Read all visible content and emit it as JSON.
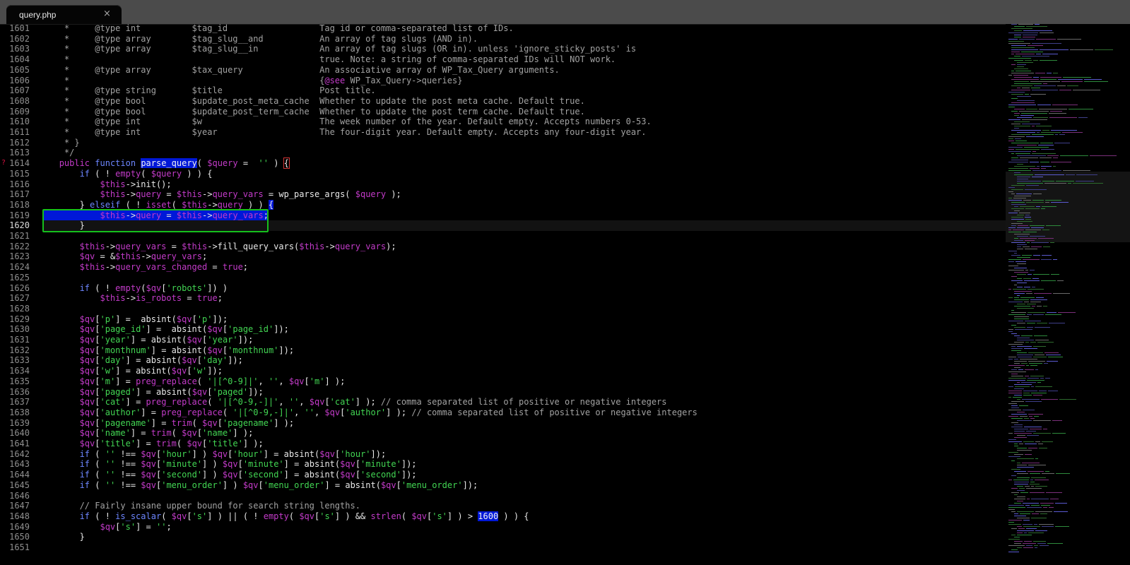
{
  "tab": {
    "title": "query.php",
    "close_label": "×"
  },
  "gutter": {
    "start": 1601,
    "current": 1620,
    "bookmark_line": 1614,
    "bookmark_glyph": "?"
  },
  "colors": {
    "background": "#000000",
    "keyword": "#6d86ff",
    "variable": "#c33bc9",
    "string": "#42d653",
    "comment": "#a2a2a2",
    "selection": "#0018d8",
    "bracket_match": "#15c01c"
  },
  "lines": [
    [
      [
        "cm",
        "    *     @type int          $tag_id                  Tag id or comma-separated list of IDs."
      ]
    ],
    [
      [
        "cm",
        "    *     @type array        $tag_slug__and           An array of tag slugs (AND in)."
      ]
    ],
    [
      [
        "cm",
        "    *     @type array        $tag_slug__in            An array of tag slugs (OR in). unless 'ignore_sticky_posts' is"
      ]
    ],
    [
      [
        "cm",
        "    *                                                 true. Note: a string of comma-separated IDs will NOT work."
      ]
    ],
    [
      [
        "cm",
        "    *     @type array        $tax_query               An associative array of WP_Tax_Query arguments."
      ]
    ],
    [
      [
        "cm",
        "    *                                                 {"
      ],
      [
        "var",
        "@see"
      ],
      [
        "cm",
        " WP_Tax_Query->queries}"
      ]
    ],
    [
      [
        "cm",
        "    *     @type string       $title                   Post title."
      ]
    ],
    [
      [
        "cm",
        "    *     @type bool         $update_post_meta_cache  Whether to update the post meta cache. Default true."
      ]
    ],
    [
      [
        "cm",
        "    *     @type bool         $update_post_term_cache  Whether to update the post term cache. Default true."
      ]
    ],
    [
      [
        "cm",
        "    *     @type int          $w                       The week number of the year. Default empty. Accepts numbers 0-53."
      ]
    ],
    [
      [
        "cm",
        "    *     @type int          $year                    The four-digit year. Default empty. Accepts any four-digit year."
      ]
    ],
    [
      [
        "cm",
        "    * }"
      ]
    ],
    [
      [
        "cm",
        "    */"
      ]
    ],
    [
      [
        "",
        "   "
      ],
      [
        "var",
        "public"
      ],
      [
        "",
        "",
        " "
      ],
      [
        "kw",
        "function"
      ],
      [
        "",
        " "
      ],
      [
        "hl",
        "parse_query"
      ],
      [
        "",
        "( "
      ],
      [
        "var",
        "$query"
      ],
      [
        "",
        " =  "
      ],
      [
        "str",
        "''"
      ],
      [
        "",
        " ) "
      ],
      [
        "boxed",
        "{"
      ]
    ],
    [
      [
        "",
        "       "
      ],
      [
        "kw",
        "if"
      ],
      [
        "",
        " ( ! "
      ],
      [
        "var",
        "empty"
      ],
      [
        "",
        "( "
      ],
      [
        "var",
        "$query"
      ],
      [
        "",
        " ) ) {"
      ]
    ],
    [
      [
        "",
        "           "
      ],
      [
        "var",
        "$this"
      ],
      [
        "",
        "->init();"
      ]
    ],
    [
      [
        "",
        "           "
      ],
      [
        "var",
        "$this"
      ],
      [
        "",
        "->"
      ],
      [
        "prop",
        "query"
      ],
      [
        "",
        " = "
      ],
      [
        "var",
        "$this"
      ],
      [
        "",
        "->"
      ],
      [
        "prop",
        "query_vars"
      ],
      [
        "",
        " = wp_parse_args( "
      ],
      [
        "var",
        "$query"
      ],
      [
        "",
        " );"
      ]
    ],
    [
      [
        "",
        "       } "
      ],
      [
        "kw",
        "elseif"
      ],
      [
        "",
        " ( ! "
      ],
      [
        "var",
        "isset"
      ],
      [
        "",
        "( "
      ],
      [
        "var",
        "$this"
      ],
      [
        "",
        "->"
      ],
      [
        "prop",
        "query"
      ],
      [
        "",
        " ) ) "
      ],
      [
        "hl",
        "{"
      ]
    ],
    [
      [
        "",
        "           "
      ],
      [
        "var",
        "$this"
      ],
      [
        "",
        "->"
      ],
      [
        "prop",
        "query"
      ],
      [
        "",
        " = "
      ],
      [
        "var",
        "$this"
      ],
      [
        "",
        "->"
      ],
      [
        "prop",
        "query_vars"
      ],
      [
        "",
        ";"
      ]
    ],
    [
      [
        "",
        "       }"
      ]
    ],
    [
      [
        "",
        ""
      ]
    ],
    [
      [
        "",
        "       "
      ],
      [
        "var",
        "$this"
      ],
      [
        "",
        "->"
      ],
      [
        "prop",
        "query_vars"
      ],
      [
        "",
        " = "
      ],
      [
        "var",
        "$this"
      ],
      [
        "",
        "->fill_query_vars("
      ],
      [
        "var",
        "$this"
      ],
      [
        "",
        "->"
      ],
      [
        "prop",
        "query_vars"
      ],
      [
        "",
        ");"
      ]
    ],
    [
      [
        "",
        "       "
      ],
      [
        "var",
        "$qv"
      ],
      [
        "",
        " = &"
      ],
      [
        "var",
        "$this"
      ],
      [
        "",
        "->"
      ],
      [
        "prop",
        "query_vars"
      ],
      [
        "",
        ";"
      ]
    ],
    [
      [
        "",
        "       "
      ],
      [
        "var",
        "$this"
      ],
      [
        "",
        "->"
      ],
      [
        "prop",
        "query_vars_changed"
      ],
      [
        "",
        " = "
      ],
      [
        "var",
        "true"
      ],
      [
        "",
        ";"
      ]
    ],
    [
      [
        "",
        ""
      ]
    ],
    [
      [
        "",
        "       "
      ],
      [
        "kw",
        "if"
      ],
      [
        "",
        " ( ! "
      ],
      [
        "var",
        "empty"
      ],
      [
        "",
        "("
      ],
      [
        "var",
        "$qv"
      ],
      [
        "",
        "["
      ],
      [
        "str",
        "'robots'"
      ],
      [
        "",
        "]) )"
      ]
    ],
    [
      [
        "",
        "           "
      ],
      [
        "var",
        "$this"
      ],
      [
        "",
        "->"
      ],
      [
        "prop",
        "is_robots"
      ],
      [
        "",
        " = "
      ],
      [
        "var",
        "true"
      ],
      [
        "",
        ";"
      ]
    ],
    [
      [
        "",
        ""
      ]
    ],
    [
      [
        "",
        "       "
      ],
      [
        "var",
        "$qv"
      ],
      [
        "",
        "["
      ],
      [
        "str",
        "'p'"
      ],
      [
        "",
        "] =  absint("
      ],
      [
        "var",
        "$qv"
      ],
      [
        "",
        "["
      ],
      [
        "str",
        "'p'"
      ],
      [
        "",
        "]);"
      ]
    ],
    [
      [
        "",
        "       "
      ],
      [
        "var",
        "$qv"
      ],
      [
        "",
        "["
      ],
      [
        "str",
        "'page_id'"
      ],
      [
        "",
        "] =  absint("
      ],
      [
        "var",
        "$qv"
      ],
      [
        "",
        "["
      ],
      [
        "str",
        "'page_id'"
      ],
      [
        "",
        "]);"
      ]
    ],
    [
      [
        "",
        "       "
      ],
      [
        "var",
        "$qv"
      ],
      [
        "",
        "["
      ],
      [
        "str",
        "'year'"
      ],
      [
        "",
        "] = absint("
      ],
      [
        "var",
        "$qv"
      ],
      [
        "",
        "["
      ],
      [
        "str",
        "'year'"
      ],
      [
        "",
        "]);"
      ]
    ],
    [
      [
        "",
        "       "
      ],
      [
        "var",
        "$qv"
      ],
      [
        "",
        "["
      ],
      [
        "str",
        "'monthnum'"
      ],
      [
        "",
        "] = absint("
      ],
      [
        "var",
        "$qv"
      ],
      [
        "",
        "["
      ],
      [
        "str",
        "'monthnum'"
      ],
      [
        "",
        "]);"
      ]
    ],
    [
      [
        "",
        "       "
      ],
      [
        "var",
        "$qv"
      ],
      [
        "",
        "["
      ],
      [
        "str",
        "'day'"
      ],
      [
        "",
        "] = absint("
      ],
      [
        "var",
        "$qv"
      ],
      [
        "",
        "["
      ],
      [
        "str",
        "'day'"
      ],
      [
        "",
        "]);"
      ]
    ],
    [
      [
        "",
        "       "
      ],
      [
        "var",
        "$qv"
      ],
      [
        "",
        "["
      ],
      [
        "str",
        "'w'"
      ],
      [
        "",
        "] = absint("
      ],
      [
        "var",
        "$qv"
      ],
      [
        "",
        "["
      ],
      [
        "str",
        "'w'"
      ],
      [
        "",
        "]);"
      ]
    ],
    [
      [
        "",
        "       "
      ],
      [
        "var",
        "$qv"
      ],
      [
        "",
        "["
      ],
      [
        "str",
        "'m'"
      ],
      [
        "",
        "] = "
      ],
      [
        "var",
        "preg_replace"
      ],
      [
        "",
        "( "
      ],
      [
        "str",
        "'|[^0-9]|'"
      ],
      [
        "",
        ", "
      ],
      [
        "str",
        "''"
      ],
      [
        "",
        ", "
      ],
      [
        "var",
        "$qv"
      ],
      [
        "",
        "["
      ],
      [
        "str",
        "'m'"
      ],
      [
        "",
        "] );"
      ]
    ],
    [
      [
        "",
        "       "
      ],
      [
        "var",
        "$qv"
      ],
      [
        "",
        "["
      ],
      [
        "str",
        "'paged'"
      ],
      [
        "",
        "] = absint("
      ],
      [
        "var",
        "$qv"
      ],
      [
        "",
        "["
      ],
      [
        "str",
        "'paged'"
      ],
      [
        "",
        "]);"
      ]
    ],
    [
      [
        "",
        "       "
      ],
      [
        "var",
        "$qv"
      ],
      [
        "",
        "["
      ],
      [
        "str",
        "'cat'"
      ],
      [
        "",
        "] = "
      ],
      [
        "var",
        "preg_replace"
      ],
      [
        "",
        "( "
      ],
      [
        "str",
        "'|[^0-9,-]|'"
      ],
      [
        "",
        ", "
      ],
      [
        "str",
        "''"
      ],
      [
        "",
        ", "
      ],
      [
        "var",
        "$qv"
      ],
      [
        "",
        "["
      ],
      [
        "str",
        "'cat'"
      ],
      [
        "",
        "] ); "
      ],
      [
        "cm",
        "// comma separated list of positive or negative integers"
      ]
    ],
    [
      [
        "",
        "       "
      ],
      [
        "var",
        "$qv"
      ],
      [
        "",
        "["
      ],
      [
        "str",
        "'author'"
      ],
      [
        "",
        "] = "
      ],
      [
        "var",
        "preg_replace"
      ],
      [
        "",
        "( "
      ],
      [
        "str",
        "'|[^0-9,-]|'"
      ],
      [
        "",
        ", "
      ],
      [
        "str",
        "''"
      ],
      [
        "",
        ", "
      ],
      [
        "var",
        "$qv"
      ],
      [
        "",
        "["
      ],
      [
        "str",
        "'author'"
      ],
      [
        "",
        "] ); "
      ],
      [
        "cm",
        "// comma separated list of positive or negative integers"
      ]
    ],
    [
      [
        "",
        "       "
      ],
      [
        "var",
        "$qv"
      ],
      [
        "",
        "["
      ],
      [
        "str",
        "'pagename'"
      ],
      [
        "",
        "] = "
      ],
      [
        "var",
        "trim"
      ],
      [
        "",
        "( "
      ],
      [
        "var",
        "$qv"
      ],
      [
        "",
        "["
      ],
      [
        "str",
        "'pagename'"
      ],
      [
        "",
        "] );"
      ]
    ],
    [
      [
        "",
        "       "
      ],
      [
        "var",
        "$qv"
      ],
      [
        "",
        "["
      ],
      [
        "str",
        "'name'"
      ],
      [
        "",
        "] = "
      ],
      [
        "var",
        "trim"
      ],
      [
        "",
        "( "
      ],
      [
        "var",
        "$qv"
      ],
      [
        "",
        "["
      ],
      [
        "str",
        "'name'"
      ],
      [
        "",
        "] );"
      ]
    ],
    [
      [
        "",
        "       "
      ],
      [
        "var",
        "$qv"
      ],
      [
        "",
        "["
      ],
      [
        "str",
        "'title'"
      ],
      [
        "",
        "] = "
      ],
      [
        "var",
        "trim"
      ],
      [
        "",
        "( "
      ],
      [
        "var",
        "$qv"
      ],
      [
        "",
        "["
      ],
      [
        "str",
        "'title'"
      ],
      [
        "",
        "] );"
      ]
    ],
    [
      [
        "",
        "       "
      ],
      [
        "kw",
        "if"
      ],
      [
        "",
        " ( "
      ],
      [
        "str",
        "''"
      ],
      [
        "",
        " !== "
      ],
      [
        "var",
        "$qv"
      ],
      [
        "",
        "["
      ],
      [
        "str",
        "'hour'"
      ],
      [
        "",
        "] ) "
      ],
      [
        "var",
        "$qv"
      ],
      [
        "",
        "["
      ],
      [
        "str",
        "'hour'"
      ],
      [
        "",
        "] = absint("
      ],
      [
        "var",
        "$qv"
      ],
      [
        "",
        "["
      ],
      [
        "str",
        "'hour'"
      ],
      [
        "",
        "]);"
      ]
    ],
    [
      [
        "",
        "       "
      ],
      [
        "kw",
        "if"
      ],
      [
        "",
        " ( "
      ],
      [
        "str",
        "''"
      ],
      [
        "",
        " !== "
      ],
      [
        "var",
        "$qv"
      ],
      [
        "",
        "["
      ],
      [
        "str",
        "'minute'"
      ],
      [
        "",
        "] ) "
      ],
      [
        "var",
        "$qv"
      ],
      [
        "",
        "["
      ],
      [
        "str",
        "'minute'"
      ],
      [
        "",
        "] = absint("
      ],
      [
        "var",
        "$qv"
      ],
      [
        "",
        "["
      ],
      [
        "str",
        "'minute'"
      ],
      [
        "",
        "]);"
      ]
    ],
    [
      [
        "",
        "       "
      ],
      [
        "kw",
        "if"
      ],
      [
        "",
        " ( "
      ],
      [
        "str",
        "''"
      ],
      [
        "",
        " !== "
      ],
      [
        "var",
        "$qv"
      ],
      [
        "",
        "["
      ],
      [
        "str",
        "'second'"
      ],
      [
        "",
        "] ) "
      ],
      [
        "var",
        "$qv"
      ],
      [
        "",
        "["
      ],
      [
        "str",
        "'second'"
      ],
      [
        "",
        "] = absint("
      ],
      [
        "var",
        "$qv"
      ],
      [
        "",
        "["
      ],
      [
        "str",
        "'second'"
      ],
      [
        "",
        "]);"
      ]
    ],
    [
      [
        "",
        "       "
      ],
      [
        "kw",
        "if"
      ],
      [
        "",
        " ( "
      ],
      [
        "str",
        "''"
      ],
      [
        "",
        " !== "
      ],
      [
        "var",
        "$qv"
      ],
      [
        "",
        "["
      ],
      [
        "str",
        "'menu_order'"
      ],
      [
        "",
        "] ) "
      ],
      [
        "var",
        "$qv"
      ],
      [
        "",
        "["
      ],
      [
        "str",
        "'menu_order'"
      ],
      [
        "",
        "] = absint("
      ],
      [
        "var",
        "$qv"
      ],
      [
        "",
        "["
      ],
      [
        "str",
        "'menu_order'"
      ],
      [
        "",
        "]);"
      ]
    ],
    [
      [
        "",
        ""
      ]
    ],
    [
      [
        "",
        "       "
      ],
      [
        "cm",
        "// Fairly insane upper bound for search string lengths."
      ]
    ],
    [
      [
        "",
        "       "
      ],
      [
        "kw",
        "if"
      ],
      [
        "",
        " ( ! "
      ],
      [
        "kw",
        "is_scalar"
      ],
      [
        "",
        "( "
      ],
      [
        "var",
        "$qv"
      ],
      [
        "",
        "["
      ],
      [
        "str",
        "'s'"
      ],
      [
        "",
        "] ) || ( ! "
      ],
      [
        "var",
        "empty"
      ],
      [
        "",
        "( "
      ],
      [
        "var",
        "$qv"
      ],
      [
        "",
        "["
      ],
      [
        "str",
        "'s'"
      ],
      [
        "",
        "] ) && "
      ],
      [
        "var",
        "strlen"
      ],
      [
        "",
        "( "
      ],
      [
        "var",
        "$qv"
      ],
      [
        "",
        "["
      ],
      [
        "str",
        "'s'"
      ],
      [
        "",
        "] ) > "
      ],
      [
        "hl",
        "1600"
      ],
      [
        "",
        " ) ) {"
      ]
    ],
    [
      [
        "",
        "           "
      ],
      [
        "var",
        "$qv"
      ],
      [
        "",
        "["
      ],
      [
        "str",
        "'s'"
      ],
      [
        "",
        "] = "
      ],
      [
        "str",
        "''"
      ],
      [
        "",
        ";"
      ]
    ],
    [
      [
        "",
        "       }"
      ]
    ],
    [
      [
        "",
        ""
      ]
    ]
  ]
}
